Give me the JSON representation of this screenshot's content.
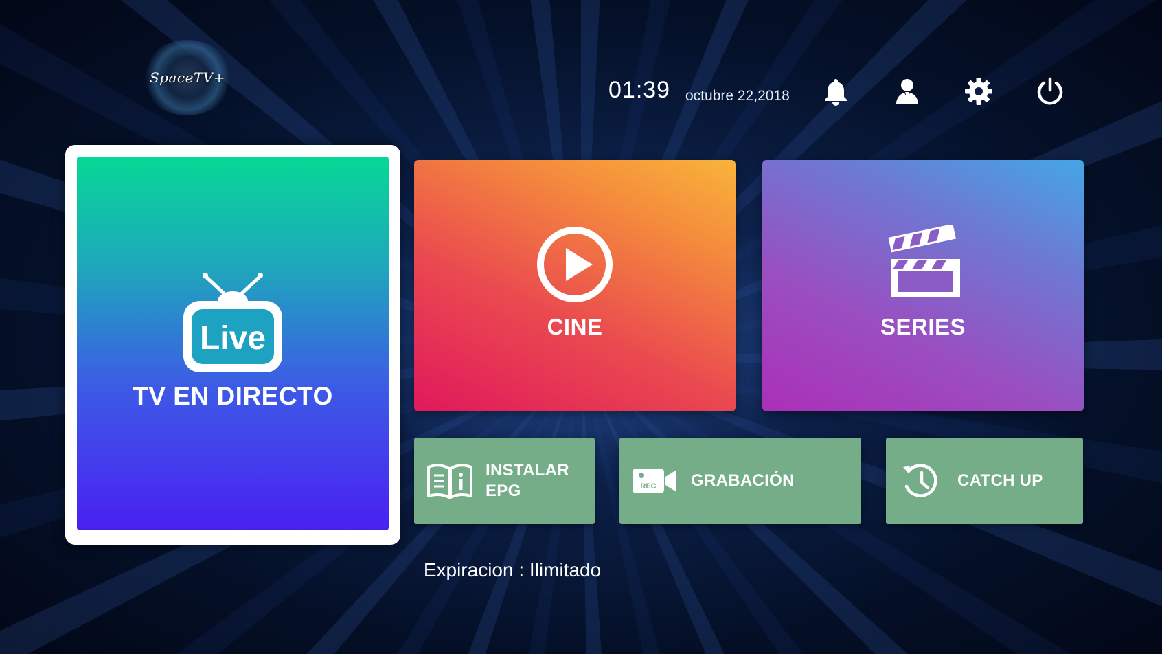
{
  "brand": {
    "logo_text": "SpaceTV+"
  },
  "header": {
    "time": "01:39",
    "date": "octubre 22,2018",
    "icons": [
      "bell-icon",
      "user-icon",
      "gear-icon",
      "power-icon"
    ]
  },
  "tiles": {
    "live": {
      "label": "TV EN DIRECTO",
      "badge": "Live",
      "icon": "live-tv-icon"
    },
    "cine": {
      "label": "CINE",
      "icon": "play-circle-icon"
    },
    "series": {
      "label": "SERIES",
      "icon": "clapperboard-icon"
    },
    "epg": {
      "label_line1": "INSTALAR",
      "label_line2": "EPG",
      "icon": "book-info-icon"
    },
    "recording": {
      "label": "GRABACIÓN",
      "icon": "rec-camera-icon",
      "icon_text": "REC"
    },
    "catchup": {
      "label": "CATCH UP",
      "icon": "history-clock-icon"
    }
  },
  "footer": {
    "expiration": "Expiracion : Ilimitado"
  },
  "colors": {
    "live_gradient": [
      "#06d895",
      "#4a20f2"
    ],
    "cine_gradient": [
      "#e0185c",
      "#f9b43a"
    ],
    "series_gradient": [
      "#ab2fb8",
      "#44a6e6"
    ],
    "small_tile": "#74ad88"
  }
}
